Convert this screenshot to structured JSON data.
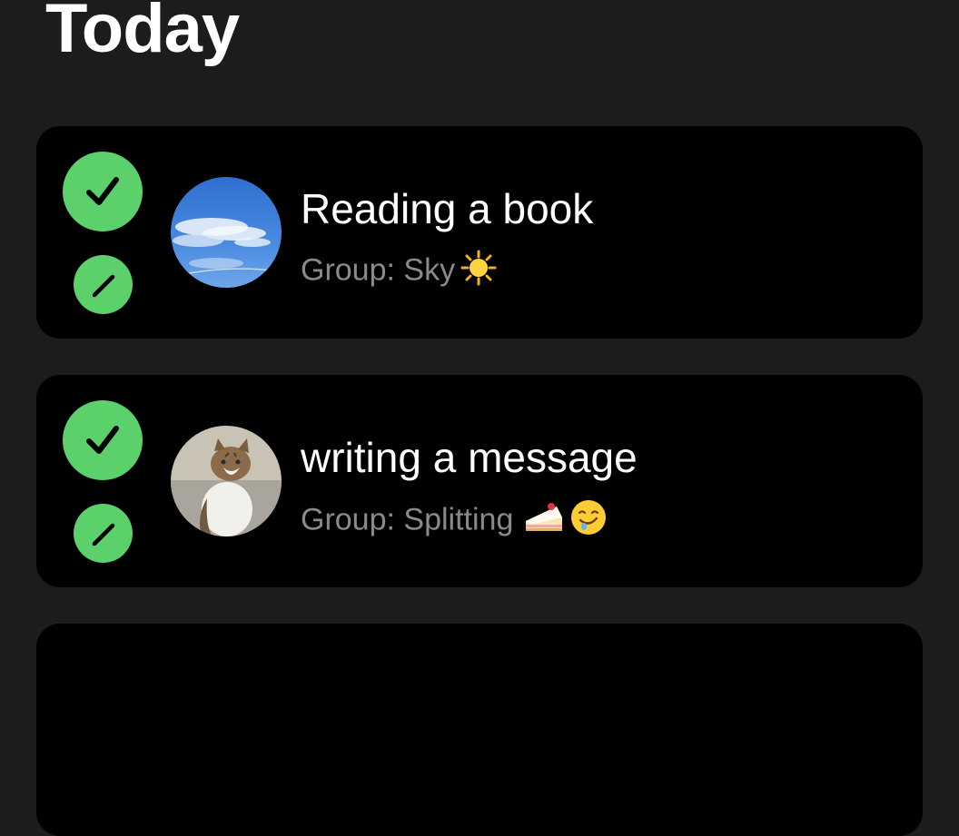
{
  "header": {
    "title": "Today"
  },
  "tasks": [
    {
      "title": "Reading a book",
      "subtitle": "Group: Sky",
      "emojis": [
        "sun-icon"
      ],
      "avatar": "sky-avatar"
    },
    {
      "title": "writing a message",
      "subtitle": "Group: Splitting",
      "emojis": [
        "cake-icon",
        "drooling-face-icon"
      ],
      "avatar": "cat-avatar"
    }
  ],
  "colors": {
    "background": "#1c1c1e",
    "card": "#000000",
    "accent_green": "#5cd06b",
    "subtitle_gray": "#8a8a8e"
  }
}
